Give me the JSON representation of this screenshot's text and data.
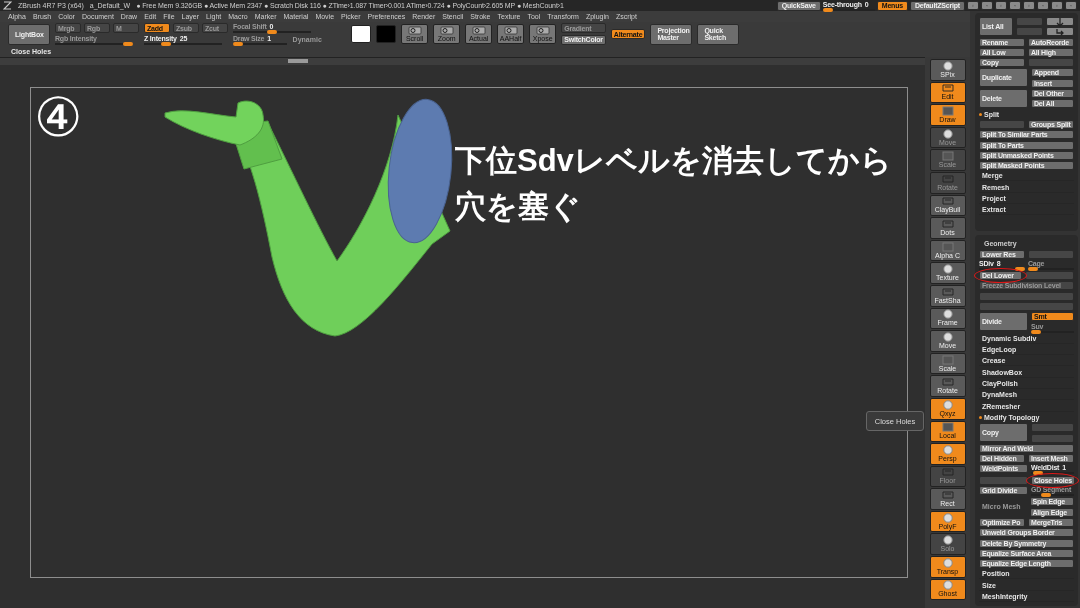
{
  "title_bar": {
    "app": "ZBrush 4R7 P3 (x64)",
    "document": "a_Default_W",
    "stats": "● Free Mem 9.326GB ● Active Mem 2347 ● Scratch Disk 116 ● ZTime›1.087 Timer›0.001 ATime›0.724 ● PolyCount›2.605 MP ● MeshCount›1",
    "controls": [
      {
        "kind": "button",
        "label": "QuickSave"
      },
      {
        "kind": "slider",
        "label": "See-through",
        "value": "0",
        "level": 0.0
      },
      {
        "kind": "button",
        "label": "Menus",
        "on": true
      },
      {
        "kind": "button",
        "label": "DefaultZScript",
        "on": false
      },
      {
        "kind": "icon"
      },
      {
        "kind": "icon"
      },
      {
        "kind": "icon"
      },
      {
        "kind": "icon"
      },
      {
        "kind": "icon"
      },
      {
        "kind": "icon"
      },
      {
        "kind": "icon"
      },
      {
        "kind": "icon"
      }
    ]
  },
  "menu": [
    "Alpha",
    "Brush",
    "Color",
    "Document",
    "Draw",
    "Edit",
    "File",
    "Layer",
    "Light",
    "Macro",
    "Marker",
    "Material",
    "Movie",
    "Picker",
    "Preferences",
    "Render",
    "Stencil",
    "Stroke",
    "Texture",
    "Tool",
    "Transform",
    "Zplugin",
    "Zscript"
  ],
  "toolbar": [
    {
      "kind": "bigbutton",
      "label": "LightBox"
    },
    {
      "kind": "stack",
      "cells": [
        {
          "kind": "row",
          "cells": [
            {
              "kind": "button",
              "label": "Mrgb",
              "disabled": true
            },
            {
              "kind": "button",
              "label": "Rgb",
              "disabled": true
            },
            {
              "kind": "button",
              "label": "M",
              "disabled": true
            }
          ]
        },
        {
          "kind": "slider",
          "label": "Rgb Intensity",
          "level": 1.0,
          "disabled": true
        }
      ]
    },
    {
      "kind": "stack",
      "cells": [
        {
          "kind": "row",
          "cells": [
            {
              "kind": "button",
              "label": "Zadd",
              "on": true
            },
            {
              "kind": "button",
              "label": "Zsub",
              "disabled": true
            },
            {
              "kind": "button",
              "label": "Zcut",
              "disabled": true
            }
          ]
        },
        {
          "kind": "slider",
          "label": "Z Intensity",
          "value": "25",
          "level": 0.25
        }
      ]
    },
    {
      "kind": "stack",
      "cells": [
        {
          "kind": "slider",
          "label": "Focal Shift",
          "value": "0",
          "level": 0.5,
          "disabled": true
        },
        {
          "kind": "row",
          "cells": [
            {
              "kind": "slider",
              "label": "Draw Size",
              "value": "1",
              "level": 0.0,
              "disabled": true
            },
            {
              "kind": "text",
              "label": "Dynamic",
              "disabled": true
            }
          ]
        }
      ]
    },
    {
      "kind": "swatch",
      "color": "#ffffff"
    },
    {
      "kind": "swatch",
      "color": "#000000"
    },
    {
      "kind": "tool",
      "label": "Scroll"
    },
    {
      "kind": "tool",
      "label": "Zoom"
    },
    {
      "kind": "tool",
      "label": "Actual"
    },
    {
      "kind": "tool",
      "label": "AAHalf"
    },
    {
      "kind": "tool",
      "label": "Xpose"
    },
    {
      "kind": "stack",
      "cells": [
        {
          "kind": "button",
          "label": "Gradient",
          "disabled": true
        },
        {
          "kind": "button",
          "label": "SwitchColor"
        }
      ]
    },
    {
      "kind": "button",
      "label": "Alternate",
      "on": true
    },
    {
      "kind": "bigbutton",
      "label": "Projection Master"
    },
    {
      "kind": "bigbutton",
      "label": "Quick Sketch"
    }
  ],
  "context_label": "Close Holes",
  "canvas": {
    "step": "④",
    "caption": [
      "下位Sdvレベルを消去してから",
      "穴を塞ぐ"
    ]
  },
  "tooltip": "Close Holes",
  "shelf": [
    {
      "label": "SPix",
      "on": false
    },
    {
      "label": "Edit",
      "on": true
    },
    {
      "label": "Draw",
      "on": true
    },
    {
      "label": "Move",
      "disabled": true
    },
    {
      "label": "Scale",
      "disabled": true
    },
    {
      "label": "Rotate",
      "disabled": true
    },
    {
      "label": "ClayBuil",
      "on": false
    },
    {
      "label": "Dots",
      "on": false
    },
    {
      "label": "Alpha C",
      "on": false
    },
    {
      "label": "Texture",
      "on": false
    },
    {
      "label": "FastSha",
      "on": false
    },
    {
      "label": "Frame",
      "on": false
    },
    {
      "label": "Move",
      "on": false
    },
    {
      "label": "Scale",
      "on": false
    },
    {
      "label": "Rotate",
      "on": false
    },
    {
      "label": "Qxyz",
      "on": true
    },
    {
      "label": "Local",
      "on": true
    },
    {
      "label": "Persp",
      "on": true
    },
    {
      "label": "Floor",
      "disabled": true
    },
    {
      "label": "Rect",
      "on": false
    },
    {
      "label": "PolyF",
      "on": true
    },
    {
      "label": "Solo",
      "disabled": true
    },
    {
      "label": "Transp",
      "on": true
    },
    {
      "label": "Ghost",
      "on": true
    }
  ],
  "panels": [
    {
      "rows": [
        {
          "kind": "row",
          "cells": [
            {
              "kind": "bigbutton",
              "label": "List All"
            },
            {
              "kind": "stack",
              "cells": [
                {
                  "kind": "blank"
                },
                {
                  "kind": "blank"
                }
              ]
            },
            {
              "kind": "stack",
              "cells": [
                {
                  "kind": "icon"
                },
                {
                  "kind": "icon"
                }
              ]
            }
          ]
        },
        {
          "kind": "row",
          "cells": [
            {
              "kind": "button",
              "label": "Rename"
            },
            {
              "kind": "button",
              "label": "AutoReorde"
            }
          ]
        },
        {
          "kind": "row",
          "cells": [
            {
              "kind": "button",
              "label": "All Low"
            },
            {
              "kind": "button",
              "label": "All High"
            }
          ]
        },
        {
          "kind": "row",
          "cells": [
            {
              "kind": "button",
              "label": "Copy"
            },
            {
              "kind": "blank"
            }
          ]
        },
        {
          "kind": "row",
          "cells": [
            {
              "kind": "bigbutton",
              "label": "Duplicate"
            },
            {
              "kind": "stack",
              "cells": [
                {
                  "kind": "button",
                  "label": "Append"
                },
                {
                  "kind": "button",
                  "label": "Insert"
                }
              ]
            }
          ]
        },
        {
          "kind": "row",
          "cells": [
            {
              "kind": "bigbutton",
              "label": "Delete"
            },
            {
              "kind": "stack",
              "cells": [
                {
                  "kind": "button",
                  "label": "Del Other"
                },
                {
                  "kind": "button",
                  "label": "Del All"
                }
              ]
            }
          ]
        },
        {
          "kind": "header",
          "label": "Split",
          "dot": true
        },
        {
          "kind": "row",
          "cells": [
            {
              "kind": "blank"
            },
            {
              "kind": "button",
              "label": "Groups Split"
            }
          ]
        },
        {
          "kind": "row",
          "cells": [
            {
              "kind": "button",
              "label": "Split To Similar Parts"
            }
          ]
        },
        {
          "kind": "row",
          "cells": [
            {
              "kind": "button",
              "label": "Split To Parts"
            }
          ]
        },
        {
          "kind": "row",
          "cells": [
            {
              "kind": "button",
              "label": "Split Unmasked Points"
            }
          ]
        },
        {
          "kind": "row",
          "cells": [
            {
              "kind": "button",
              "label": "Split Masked Points"
            }
          ]
        },
        {
          "kind": "item",
          "label": "Merge"
        },
        {
          "kind": "item",
          "label": "Remesh"
        },
        {
          "kind": "item",
          "label": "Project"
        },
        {
          "kind": "item",
          "label": "Extract"
        }
      ]
    },
    {
      "rows": [
        {
          "kind": "title",
          "label": "Geometry"
        },
        {
          "kind": "row",
          "cells": [
            {
              "kind": "button",
              "label": "Lower Res"
            },
            {
              "kind": "blank"
            }
          ]
        },
        {
          "kind": "row",
          "cells": [
            {
              "kind": "slider",
              "label": "SDiv",
              "value": "8",
              "level": 1.0
            },
            {
              "kind": "slider",
              "label": "Cage",
              "level": 0.0,
              "disabled": true
            }
          ]
        },
        {
          "kind": "row",
          "cells": [
            {
              "kind": "button",
              "label": "Del Lower",
              "circled": true
            },
            {
              "kind": "blank"
            }
          ]
        },
        {
          "kind": "row",
          "cells": [
            {
              "kind": "button",
              "label": "Freeze Subdivision Level",
              "disabled": true
            }
          ]
        },
        {
          "kind": "row",
          "cells": [
            {
              "kind": "blank"
            }
          ]
        },
        {
          "kind": "row",
          "cells": [
            {
              "kind": "blank"
            }
          ]
        },
        {
          "kind": "row",
          "cells": [
            {
              "kind": "bigbutton",
              "label": "Divide"
            },
            {
              "kind": "stack",
              "cells": [
                {
                  "kind": "button",
                  "label": "Smt",
                  "on": true
                },
                {
                  "kind": "slider",
                  "label": "Suv",
                  "level": 0.0,
                  "disabled": true
                }
              ]
            }
          ]
        },
        {
          "kind": "item",
          "label": "Dynamic Subdiv"
        },
        {
          "kind": "item",
          "label": "EdgeLoop"
        },
        {
          "kind": "item",
          "label": "Crease"
        },
        {
          "kind": "item",
          "label": "ShadowBox"
        },
        {
          "kind": "item",
          "label": "ClayPolish"
        },
        {
          "kind": "item",
          "label": "DynaMesh"
        },
        {
          "kind": "item",
          "label": "ZRemesher"
        },
        {
          "kind": "header",
          "label": "Modify Topology",
          "dot": true
        },
        {
          "kind": "row",
          "cells": [
            {
              "kind": "bigbutton",
              "label": "Copy"
            },
            {
              "kind": "stack",
              "cells": [
                {
                  "kind": "blank"
                },
                {
                  "kind": "blank"
                }
              ]
            }
          ]
        },
        {
          "kind": "row",
          "cells": [
            {
              "kind": "button",
              "label": "Mirror And Weld"
            }
          ]
        },
        {
          "kind": "row",
          "cells": [
            {
              "kind": "button",
              "label": "Del Hidden"
            },
            {
              "kind": "button",
              "label": "Insert Mesh"
            }
          ]
        },
        {
          "kind": "row",
          "cells": [
            {
              "kind": "button",
              "label": "WeldPoints"
            },
            {
              "kind": "slider",
              "label": "WeldDist",
              "value": "1",
              "level": 0.05
            }
          ]
        },
        {
          "kind": "row",
          "cells": [
            {
              "kind": "blank"
            },
            {
              "kind": "button",
              "label": "Close Holes",
              "circled": true
            }
          ]
        },
        {
          "kind": "row",
          "cells": [
            {
              "kind": "button",
              "label": "Grid Divide"
            },
            {
              "kind": "slider",
              "label": "GD Segment",
              "level": 0.3,
              "disabled": true
            }
          ]
        },
        {
          "kind": "row",
          "cells": [
            {
              "kind": "text",
              "label": "Micro Mesh",
              "disabled": true
            },
            {
              "kind": "stack",
              "cells": [
                {
                  "kind": "button",
                  "label": "Spin Edge"
                },
                {
                  "kind": "button",
                  "label": "Align Edge"
                }
              ]
            }
          ]
        },
        {
          "kind": "row",
          "cells": [
            {
              "kind": "button",
              "label": "Optimize Po"
            },
            {
              "kind": "button",
              "label": "MergeTris"
            }
          ]
        },
        {
          "kind": "row",
          "cells": [
            {
              "kind": "button",
              "label": "Unweld Groups Border"
            }
          ]
        },
        {
          "kind": "row",
          "cells": [
            {
              "kind": "button",
              "label": "Delete By Symmetry"
            }
          ]
        },
        {
          "kind": "row",
          "cells": [
            {
              "kind": "button",
              "label": "Equalize Surface Area"
            }
          ]
        },
        {
          "kind": "row",
          "cells": [
            {
              "kind": "button",
              "label": "Equalize Edge Length"
            }
          ]
        },
        {
          "kind": "item",
          "label": "Position"
        },
        {
          "kind": "item",
          "label": "Size"
        },
        {
          "kind": "item",
          "label": "MeshIntegrity"
        }
      ]
    }
  ]
}
